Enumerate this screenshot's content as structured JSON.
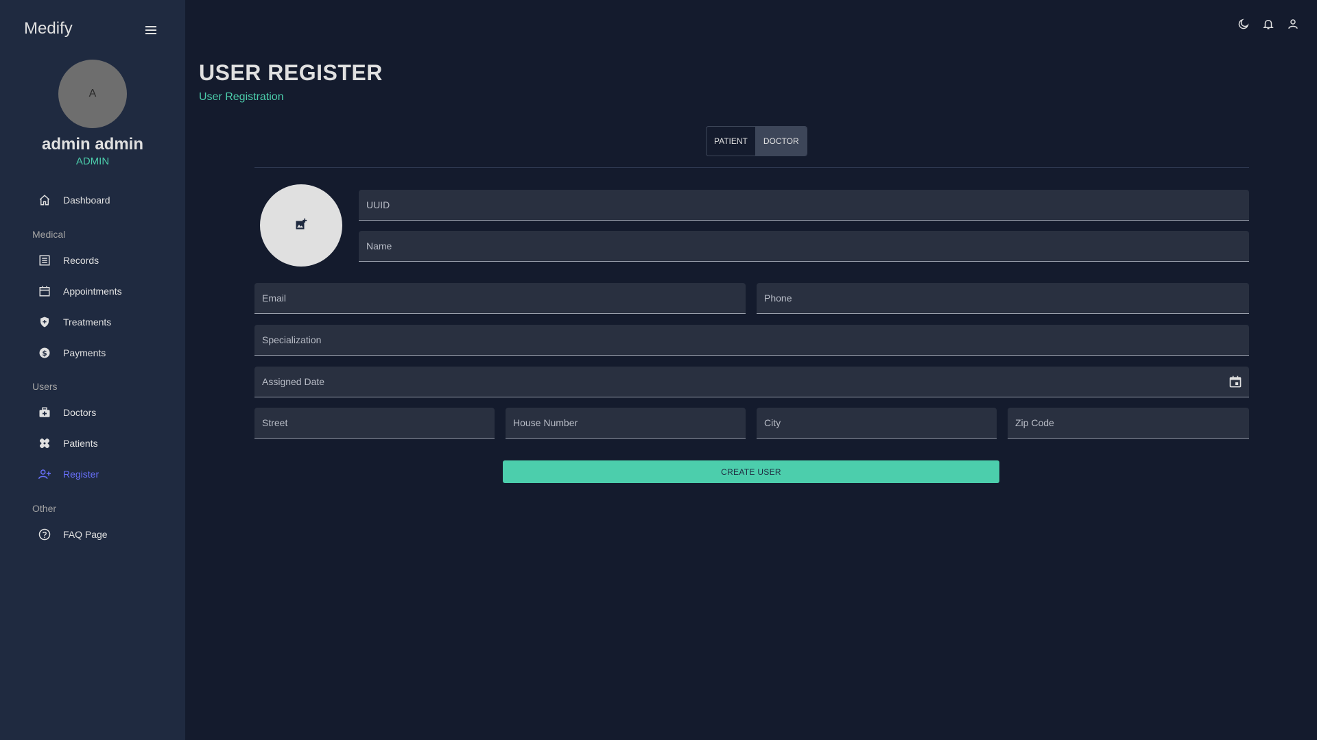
{
  "app": {
    "brand": "Medify"
  },
  "user": {
    "avatar_initial": "A",
    "name": "admin admin",
    "role": "ADMIN"
  },
  "sidebar": {
    "items": [
      {
        "label": "Dashboard",
        "icon": "home-icon"
      },
      {
        "label": "Records",
        "icon": "list-icon"
      },
      {
        "label": "Appointments",
        "icon": "calendar-icon"
      },
      {
        "label": "Treatments",
        "icon": "shield-icon"
      },
      {
        "label": "Payments",
        "icon": "dollar-icon"
      },
      {
        "label": "Doctors",
        "icon": "medical-bag-icon"
      },
      {
        "label": "Patients",
        "icon": "bandage-icon"
      },
      {
        "label": "Register",
        "icon": "person-add-icon"
      },
      {
        "label": "FAQ Page",
        "icon": "help-icon"
      }
    ],
    "sections": [
      "Medical",
      "Users",
      "Other"
    ],
    "active_item": "Register"
  },
  "topbar": {
    "icons": [
      "dark-mode-icon",
      "notifications-icon",
      "profile-icon"
    ]
  },
  "header": {
    "title": "USER REGISTER",
    "subtitle": "User Registration"
  },
  "role_toggle": {
    "patient_label": "PATIENT",
    "doctor_label": "DOCTOR",
    "selected": "DOCTOR"
  },
  "form": {
    "uuid_placeholder": "UUID",
    "name_placeholder": "Name",
    "email_placeholder": "Email",
    "phone_placeholder": "Phone",
    "specialization_placeholder": "Specialization",
    "assigned_date_placeholder": "Assigned Date",
    "street_placeholder": "Street",
    "house_number_placeholder": "House Number",
    "city_placeholder": "City",
    "zip_code_placeholder": "Zip Code",
    "submit_label": "CREATE USER"
  },
  "colors": {
    "accent": "#4cceac",
    "active_nav": "#6870fa",
    "background": "#141b2d",
    "sidebar": "#1f2a40"
  }
}
